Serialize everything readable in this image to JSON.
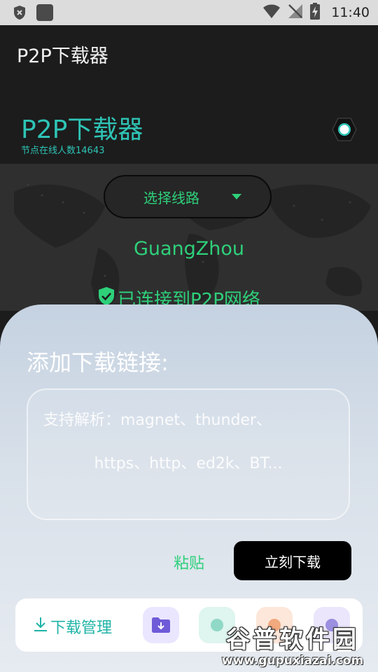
{
  "status_bar": {
    "time": "11:40",
    "left_icons": [
      "shield-x-icon",
      "app-square-icon"
    ],
    "right_icons": [
      "wifi-icon",
      "no-signal-icon",
      "battery-charging-icon"
    ]
  },
  "app_bar": {
    "title": "P2P下载器"
  },
  "header": {
    "brand_title": "P2P下载器",
    "online_nodes": "节点在线人数14643",
    "status_icon": "connection-status-icon"
  },
  "route": {
    "select_label": "选择线路",
    "city": "GuangZhou",
    "connected_text": "已连接到P2P网络"
  },
  "sheet": {
    "title": "添加下载链接:",
    "input_value": "",
    "placeholder_line1": "支持解析：magnet、thunder、",
    "placeholder_line2": "https、http、ed2k、BT...",
    "paste_label": "粘贴",
    "download_label": "立刻下载"
  },
  "bottom_bar": {
    "download_manager_label": "下载管理",
    "icons": [
      "download-icon",
      "folder-icon",
      "tool-icon-2",
      "tool-icon-3",
      "tool-icon-4"
    ]
  },
  "watermark": {
    "text": "谷普软件园",
    "url": "www.gupuxiazai.com"
  },
  "colors": {
    "accent_teal": "#2ec4b6",
    "accent_green": "#2ed07a",
    "dark_bg": "#1c1c1c",
    "button_black": "#000000"
  }
}
